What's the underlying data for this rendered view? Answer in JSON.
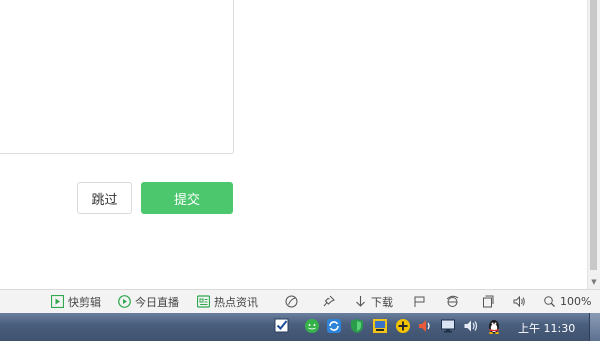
{
  "form": {
    "skip_label": "跳过",
    "submit_label": "提交"
  },
  "status_bar": {
    "items": [
      {
        "icon": "quick-cut-icon",
        "label": "快剪辑"
      },
      {
        "icon": "live-today-icon",
        "label": "今日直播"
      },
      {
        "icon": "hot-news-icon",
        "label": "热点资讯"
      }
    ],
    "download_label": "下载",
    "zoom": "100%"
  },
  "taskbar": {
    "clock": "上午 11:30"
  },
  "colors": {
    "accent": "#4CC76E",
    "taskbar": "#4A5F7E"
  }
}
